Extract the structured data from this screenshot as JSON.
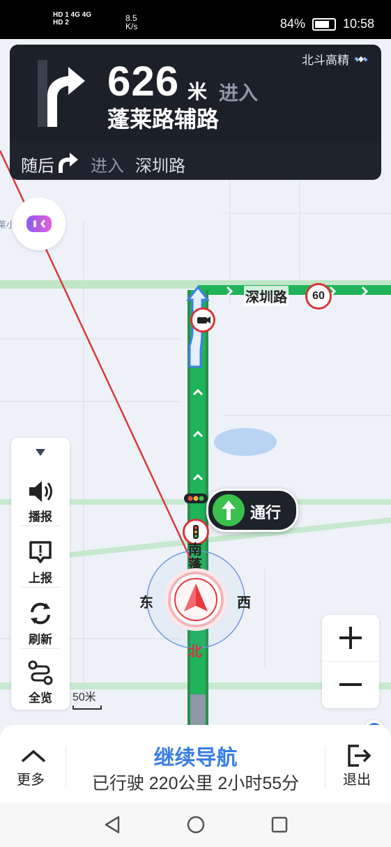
{
  "status_bar": {
    "network_top": "HD 1 4G 4G",
    "network_bottom": "HD 2",
    "speed": "8.5 K/s",
    "battery_percent": "84%",
    "battery_level": 84,
    "time": "10:58"
  },
  "guidance": {
    "distance": "626",
    "unit": "米",
    "action": "进入",
    "road": "蓬莱路辅路",
    "positioning": "北斗高精",
    "next_label": "随后",
    "next_action": "进入",
    "next_road": "深圳路"
  },
  "map": {
    "road_label": "深圳路",
    "speed_limit": "60",
    "signal_text": "通行",
    "vertical_road_label": "南蓬",
    "compass": {
      "east": "东",
      "west": "西",
      "north": "北"
    },
    "scale": "50米",
    "partial_poi": "莱小"
  },
  "sidebar": {
    "items": [
      {
        "label": "播报",
        "icon": "speaker-icon"
      },
      {
        "label": "上报",
        "icon": "report-icon"
      },
      {
        "label": "刷新",
        "icon": "refresh-icon"
      },
      {
        "label": "全览",
        "icon": "route-overview-icon"
      }
    ]
  },
  "bottom": {
    "more": "更多",
    "title": "继续导航",
    "traveled": "已行驶 220公里 2小时55分",
    "exit": "退出"
  },
  "colors": {
    "route_green": "#1fb35a",
    "nav_card_bg": "#1f232d",
    "accent_blue": "#3a7ee3",
    "car_red": "#e8363d"
  }
}
